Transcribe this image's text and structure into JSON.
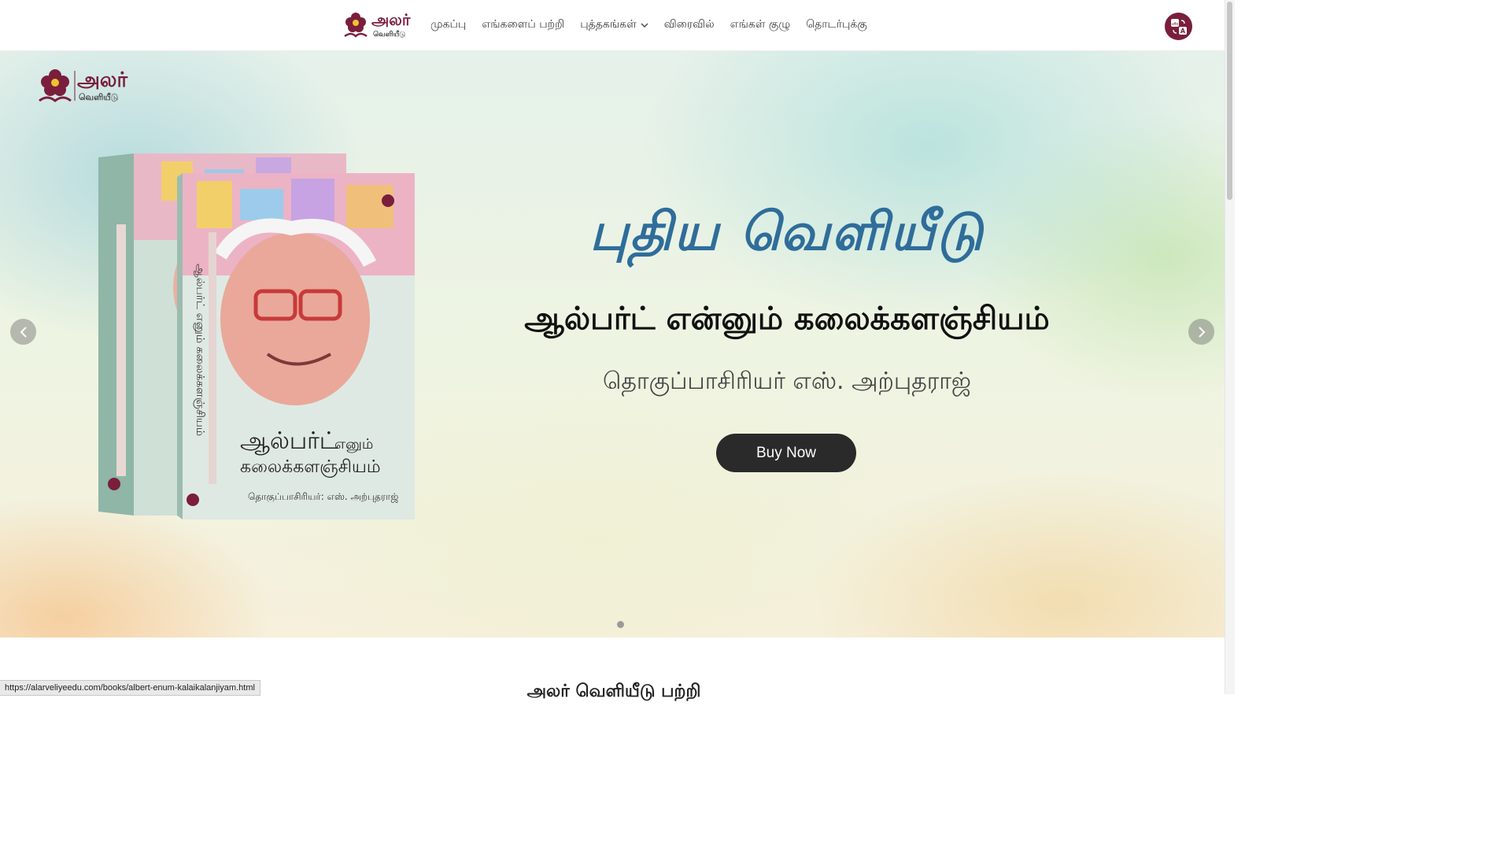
{
  "nav": {
    "logo_text": "அலர்",
    "logo_subtext": "வெளியீடு",
    "links": [
      "முகப்பு",
      "எங்களைப் பற்றி",
      "புத்தகங்கள்",
      "விரைவில்",
      "எங்கள் குழு",
      "தொடர்புக்கு"
    ],
    "language_icon": "translate-icon"
  },
  "hero": {
    "logo_text": "அலர்",
    "logo_subtext": "வெளியீடு",
    "headline": "புதிய வெளியீடு",
    "book_title": "ஆல்பர்ட் என்னும் கலைக்களஞ்சியம்",
    "editor": "தொகுப்பாசிரியர் எஸ். அற்புதராஜ்",
    "buy_label": "Buy Now",
    "cover": {
      "title_main": "ஆல்பர்ட்",
      "title_small": "எனும்",
      "title_line2": "கலைக்களஞ்சியம்",
      "editor": "தொகுப்பாசிரியர்: எஸ். அற்புதராஜ்",
      "spine": "ஆல்பர்ட் எனும் கலைக்களஞ்சியம்"
    },
    "slide_count": 1,
    "active_slide": 1
  },
  "section": {
    "heading": "அலர் வெளியீடு பற்றி"
  },
  "status_bar": {
    "url": "https://alarveliyeedu.com/books/albert-enum-kalaikalanjiyam.html"
  },
  "colors": {
    "brand": "#7a1e3c",
    "headline": "#2f6d9a",
    "button": "#2a2a2a"
  }
}
